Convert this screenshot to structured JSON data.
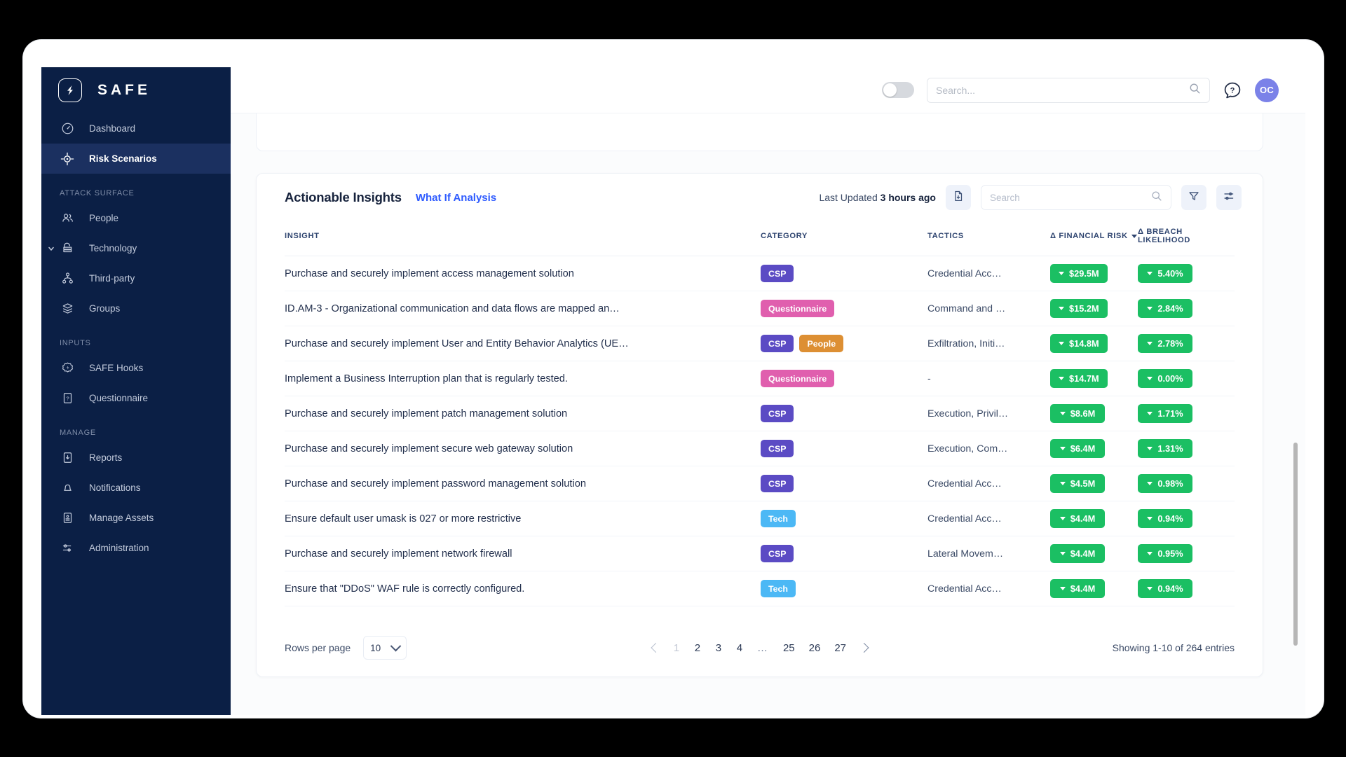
{
  "brand": {
    "name": "SAFE"
  },
  "sidebar": {
    "items": [
      {
        "label": "Dashboard",
        "icon": "gauge-icon",
        "active": false,
        "type": "item"
      },
      {
        "label": "Risk Scenarios",
        "icon": "target-icon",
        "active": true,
        "type": "item"
      },
      {
        "label": "ATTACK SURFACE",
        "type": "section"
      },
      {
        "label": "People",
        "icon": "people-icon",
        "active": false,
        "type": "item"
      },
      {
        "label": "Technology",
        "icon": "technology-icon",
        "active": false,
        "type": "item",
        "expandable": true
      },
      {
        "label": "Third-party",
        "icon": "third-party-icon",
        "active": false,
        "type": "item"
      },
      {
        "label": "Groups",
        "icon": "groups-icon",
        "active": false,
        "type": "item"
      },
      {
        "label": "INPUTS",
        "type": "section"
      },
      {
        "label": "SAFE Hooks",
        "icon": "hooks-icon",
        "active": false,
        "type": "item"
      },
      {
        "label": "Questionnaire",
        "icon": "questionnaire-icon",
        "active": false,
        "type": "item"
      },
      {
        "label": "MANAGE",
        "type": "section"
      },
      {
        "label": "Reports",
        "icon": "reports-icon",
        "active": false,
        "type": "item"
      },
      {
        "label": "Notifications",
        "icon": "bell-icon",
        "active": false,
        "type": "item"
      },
      {
        "label": "Manage Assets",
        "icon": "assets-icon",
        "active": false,
        "type": "item"
      },
      {
        "label": "Administration",
        "icon": "sliders-icon",
        "active": false,
        "type": "item"
      }
    ]
  },
  "topbar": {
    "search_placeholder": "Search...",
    "search_value": "",
    "avatar_initials": "OC",
    "toggle_on": false
  },
  "panel": {
    "title": "Actionable Insights",
    "link": "What If Analysis",
    "last_updated_label": "Last Updated",
    "last_updated_value": "3 hours ago",
    "search_placeholder": "Search",
    "search_value": "",
    "export_icon": "export-file-icon",
    "filter_icon": "filter-icon",
    "settings_icon": "sliders-settings-icon"
  },
  "table": {
    "columns": [
      "INSIGHT",
      "CATEGORY",
      "TACTICS",
      "Δ FINANCIAL RISK",
      "Δ BREACH LIKELIHOOD"
    ],
    "sorted_column": "Δ FINANCIAL RISK",
    "rows": [
      {
        "insight": "Purchase and securely implement access management solution",
        "categories": [
          {
            "label": "CSP",
            "color": "#5b4bc4"
          }
        ],
        "tactics": "Credential Acc…",
        "financial_risk": "$29.5M",
        "breach_likelihood": "5.40%"
      },
      {
        "insight": "ID.AM-3 - Organizational communication and data flows are mapped an…",
        "categories": [
          {
            "label": "Questionnaire",
            "color": "#e05fae"
          }
        ],
        "tactics": "Command and …",
        "financial_risk": "$15.2M",
        "breach_likelihood": "2.84%"
      },
      {
        "insight": "Purchase and securely implement User and Entity Behavior Analytics (UE…",
        "categories": [
          {
            "label": "CSP",
            "color": "#5b4bc4"
          },
          {
            "label": "People",
            "color": "#dd8f33"
          }
        ],
        "tactics": "Exfiltration, Initi…",
        "financial_risk": "$14.8M",
        "breach_likelihood": "2.78%"
      },
      {
        "insight": "Implement a Business Interruption plan that is regularly tested.",
        "categories": [
          {
            "label": "Questionnaire",
            "color": "#e05fae"
          }
        ],
        "tactics": "-",
        "financial_risk": "$14.7M",
        "breach_likelihood": "0.00%"
      },
      {
        "insight": "Purchase and securely implement patch management solution",
        "categories": [
          {
            "label": "CSP",
            "color": "#5b4bc4"
          }
        ],
        "tactics": "Execution, Privil…",
        "financial_risk": "$8.6M",
        "breach_likelihood": "1.71%"
      },
      {
        "insight": "Purchase and securely implement secure web gateway solution",
        "categories": [
          {
            "label": "CSP",
            "color": "#5b4bc4"
          }
        ],
        "tactics": "Execution, Com…",
        "financial_risk": "$6.4M",
        "breach_likelihood": "1.31%"
      },
      {
        "insight": "Purchase and securely implement password management solution",
        "categories": [
          {
            "label": "CSP",
            "color": "#5b4bc4"
          }
        ],
        "tactics": "Credential Acc…",
        "financial_risk": "$4.5M",
        "breach_likelihood": "0.98%"
      },
      {
        "insight": "Ensure default user umask is 027 or more restrictive",
        "categories": [
          {
            "label": "Tech",
            "color": "#4cb8f5"
          }
        ],
        "tactics": "Credential Acc…",
        "financial_risk": "$4.4M",
        "breach_likelihood": "0.94%"
      },
      {
        "insight": "Purchase and securely implement network firewall",
        "categories": [
          {
            "label": "CSP",
            "color": "#5b4bc4"
          }
        ],
        "tactics": "Lateral Movem…",
        "financial_risk": "$4.4M",
        "breach_likelihood": "0.95%"
      },
      {
        "insight": "Ensure that \"DDoS\" WAF rule is correctly configured.",
        "categories": [
          {
            "label": "Tech",
            "color": "#4cb8f5"
          }
        ],
        "tactics": "Credential Acc…",
        "financial_risk": "$4.4M",
        "breach_likelihood": "0.94%"
      }
    ]
  },
  "pagination": {
    "rows_per_page_label": "Rows per page",
    "rows_per_page_value": "10",
    "pages": [
      "1",
      "2",
      "3",
      "4",
      "…",
      "25",
      "26",
      "27"
    ],
    "current_page": "1",
    "showing": "Showing 1-10 of 264 entries"
  },
  "colors": {
    "sidebar_bg": "#0b1f45",
    "sidebar_active": "#1b3060",
    "accent_link": "#2e5bff",
    "metric_green": "#1bbf63",
    "avatar": "#7b82e8"
  }
}
